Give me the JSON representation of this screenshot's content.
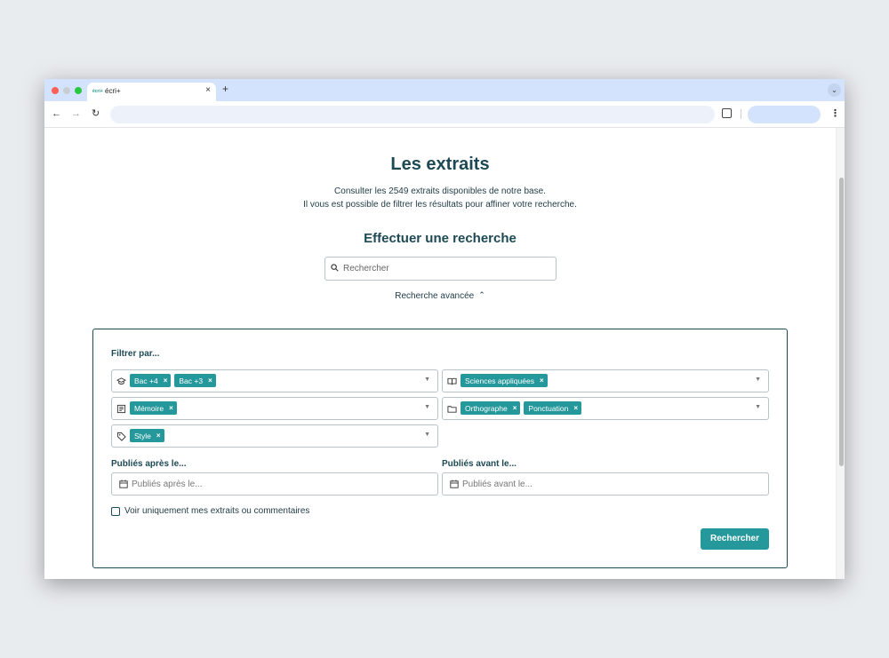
{
  "browser": {
    "tab_title": "écri+",
    "tab_favicon_text": "écri+",
    "tab_close": "×",
    "new_tab": "+",
    "tab_menu": "⌄",
    "back": "←",
    "forward": "→",
    "reload": "↻",
    "menu": "⋮"
  },
  "page": {
    "title": "Les extraits",
    "intro_line1": "Consulter les 2549 extraits disponibles de notre base.",
    "intro_line2": "Il vous est possible de filtrer les résultats pour affiner votre recherche.",
    "search_heading": "Effectuer une recherche",
    "search_placeholder": "Rechercher",
    "advanced_label": "Recherche avancée",
    "advanced_chevron": "⌃"
  },
  "filters": {
    "label": "Filtrer par...",
    "level": {
      "icon": "graduation-cap-icon",
      "chips": [
        "Bac +4",
        "Bac +3"
      ]
    },
    "discipline": {
      "icon": "book-icon",
      "chips": [
        "Sciences appliquées"
      ]
    },
    "document_type": {
      "icon": "document-type-icon",
      "chips": [
        "Mémoire"
      ]
    },
    "category": {
      "icon": "folder-icon",
      "chips": [
        "Orthographe",
        "Ponctuation"
      ]
    },
    "tag": {
      "icon": "tag-icon",
      "chips": [
        "Style"
      ]
    },
    "chip_remove": "×",
    "caret": "▼",
    "after_label": "Publiés après le...",
    "after_placeholder": "Publiés après le...",
    "before_label": "Publiés avant le...",
    "before_placeholder": "Publiés avant le...",
    "only_mine_label": "Voir uniquement mes extraits ou commentaires",
    "submit_label": "Rechercher"
  },
  "colors": {
    "accent": "#25989b",
    "heading": "#1d4954",
    "tabstrip": "#d3e3fd"
  }
}
